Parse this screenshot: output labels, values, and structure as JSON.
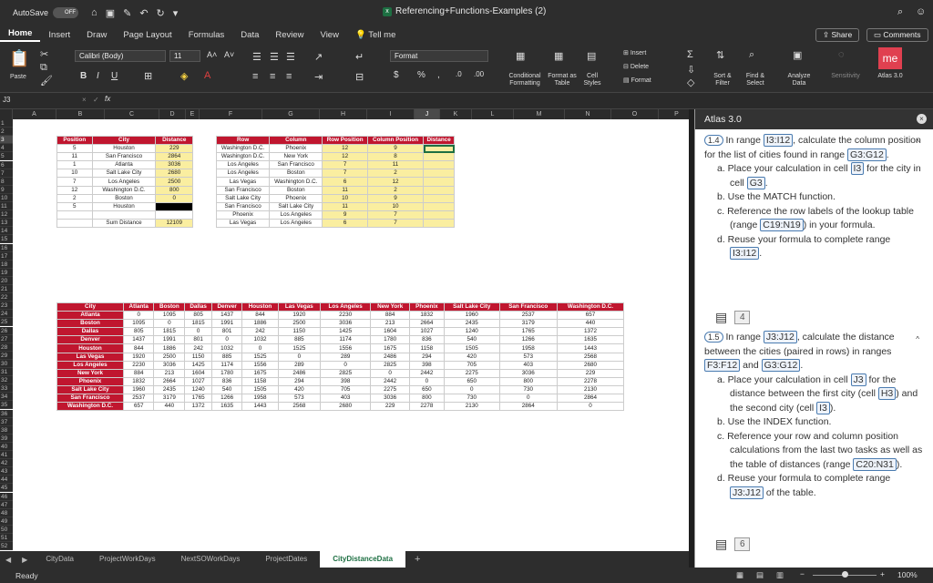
{
  "titlebar": {
    "autosave": "AutoSave",
    "toggle": "OFF",
    "doc_title": "Referencing+Functions-Examples (2)"
  },
  "tabs": [
    "Home",
    "Insert",
    "Draw",
    "Page Layout",
    "Formulas",
    "Data",
    "Review",
    "View"
  ],
  "tell_me": "Tell me",
  "share": "Share",
  "comments": "Comments",
  "ribbon": {
    "paste": "Paste",
    "font": "Calibri (Body)",
    "size": "11",
    "format": "Format",
    "cond": "Conditional Formatting",
    "fmt_table": "Format as Table",
    "cell_styles": "Cell Styles",
    "insert": "Insert",
    "delete": "Delete",
    "sort": "Sort & Filter",
    "find": "Find & Select",
    "analyze": "Analyze Data",
    "sensitivity": "Sensitivity",
    "atlas": "Atlas 3.0",
    "atlas_logo": "me"
  },
  "formula_bar": {
    "namebox": "J3",
    "fx": "fx"
  },
  "columns": [
    "A",
    "B",
    "C",
    "D",
    "E",
    "F",
    "G",
    "H",
    "I",
    "J",
    "K",
    "L",
    "M",
    "N",
    "O",
    "P"
  ],
  "table1": {
    "headers": [
      "Position",
      "City",
      "Distance"
    ],
    "rows": [
      [
        "5",
        "Houston",
        "229"
      ],
      [
        "11",
        "San Francisco",
        "2864"
      ],
      [
        "1",
        "Atlanta",
        "3036"
      ],
      [
        "10",
        "Salt Lake City",
        "2680"
      ],
      [
        "7",
        "Los Angeles",
        "2500"
      ],
      [
        "12",
        "Washington D.C.",
        "800"
      ],
      [
        "2",
        "Boston",
        "0"
      ],
      [
        "5",
        "Houston",
        ""
      ]
    ],
    "sum_label": "Sum Distance",
    "sum_value": "12109"
  },
  "table2": {
    "headers": [
      "Row",
      "Column",
      "Row Position",
      "Column Position",
      "Distance"
    ],
    "rows": [
      [
        "Washington D.C.",
        "Phoenix",
        "12",
        "9",
        ""
      ],
      [
        "Washington D.C.",
        "New York",
        "12",
        "8",
        ""
      ],
      [
        "Los Angeles",
        "San Francisco",
        "7",
        "11",
        ""
      ],
      [
        "Los Angeles",
        "Boston",
        "7",
        "2",
        ""
      ],
      [
        "Las Vegas",
        "Washington D.C.",
        "6",
        "12",
        ""
      ],
      [
        "San Francisco",
        "Boston",
        "11",
        "2",
        ""
      ],
      [
        "Salt Lake City",
        "Phoenix",
        "10",
        "9",
        ""
      ],
      [
        "San Francisco",
        "Salt Lake City",
        "11",
        "10",
        ""
      ],
      [
        "Phoenix",
        "Los Angeles",
        "9",
        "7",
        ""
      ],
      [
        "Las Vegas",
        "Los Angeles",
        "6",
        "7",
        ""
      ]
    ]
  },
  "matrix": {
    "headers": [
      "City",
      "Atlanta",
      "Boston",
      "Dallas",
      "Denver",
      "Houston",
      "Las Vegas",
      "Los Angeles",
      "New York",
      "Phoenix",
      "Salt Lake City",
      "San Francisco",
      "Washington D.C."
    ],
    "rows": [
      [
        "Atlanta",
        "0",
        "1095",
        "805",
        "1437",
        "844",
        "1920",
        "2230",
        "884",
        "1832",
        "1960",
        "2537",
        "657"
      ],
      [
        "Boston",
        "1095",
        "0",
        "1815",
        "1991",
        "1886",
        "2500",
        "3036",
        "213",
        "2664",
        "2435",
        "3179",
        "440"
      ],
      [
        "Dallas",
        "805",
        "1815",
        "0",
        "801",
        "242",
        "1150",
        "1425",
        "1604",
        "1027",
        "1240",
        "1765",
        "1372"
      ],
      [
        "Denver",
        "1437",
        "1991",
        "801",
        "0",
        "1032",
        "885",
        "1174",
        "1780",
        "836",
        "540",
        "1266",
        "1635"
      ],
      [
        "Houston",
        "844",
        "1886",
        "242",
        "1032",
        "0",
        "1525",
        "1556",
        "1675",
        "1158",
        "1505",
        "1958",
        "1443"
      ],
      [
        "Las Vegas",
        "1920",
        "2500",
        "1150",
        "885",
        "1525",
        "0",
        "289",
        "2486",
        "294",
        "420",
        "573",
        "2568"
      ],
      [
        "Los Angeles",
        "2230",
        "3036",
        "1425",
        "1174",
        "1556",
        "289",
        "0",
        "2825",
        "398",
        "705",
        "403",
        "2680"
      ],
      [
        "New York",
        "884",
        "213",
        "1604",
        "1780",
        "1675",
        "2486",
        "2825",
        "0",
        "2442",
        "2275",
        "3036",
        "229"
      ],
      [
        "Phoenix",
        "1832",
        "2664",
        "1027",
        "836",
        "1158",
        "294",
        "398",
        "2442",
        "0",
        "650",
        "800",
        "2278"
      ],
      [
        "Salt Lake City",
        "1960",
        "2435",
        "1240",
        "540",
        "1505",
        "420",
        "705",
        "2275",
        "650",
        "0",
        "730",
        "2130"
      ],
      [
        "San Francisco",
        "2537",
        "3179",
        "1765",
        "1266",
        "1958",
        "573",
        "403",
        "3036",
        "800",
        "730",
        "0",
        "2864"
      ],
      [
        "Washington D.C.",
        "657",
        "440",
        "1372",
        "1635",
        "1443",
        "2568",
        "2680",
        "229",
        "2278",
        "2130",
        "2864",
        "0"
      ]
    ]
  },
  "sheet_tabs": [
    "CityData",
    "ProjectWorkDays",
    "NextSOWorkDays",
    "ProjectDates",
    "CityDistanceData"
  ],
  "status": {
    "ready": "Ready",
    "zoom": "100%"
  },
  "pane": {
    "title": "Atlas 3.0",
    "t14": {
      "num": "1.4",
      "intro_a": "In range ",
      "r1": "I3:I12",
      "intro_b": ", calculate the column position for the list of cities found in range ",
      "r2": "G3:G12",
      "intro_c": ".",
      "a": "a. Place your calculation in cell ",
      "a_ref": "I3",
      "a_b": " for the city in cell ",
      "a_ref2": "G3",
      "a_c": ".",
      "b": "b. Use the MATCH function.",
      "c": "c. Reference the row labels of the lookup table (range ",
      "c_ref": "C19:N19",
      "c_b": ") in your formula.",
      "d": "d. Reuse your formula to complete range ",
      "d_ref": "I3:I12",
      "d_b": ".",
      "count": "4"
    },
    "t15": {
      "num": "1.5",
      "intro_a": "In range ",
      "r1": "J3:J12",
      "intro_b": ", calculate the distance between the cities (paired in rows) in ranges ",
      "r2": "F3:F12",
      "intro_c": " and ",
      "r3": "G3:G12",
      "intro_d": ".",
      "a": "a. Place your calculation in cell ",
      "a_ref": "J3",
      "a_b": " for the distance between the first city (cell ",
      "a_ref2": "H3",
      "a_c": ") and the second city (cell ",
      "a_ref3": "I3",
      "a_d": ").",
      "b": "b. Use the INDEX function.",
      "c": "c. Reference your row and column position calculations from the last two tasks as well as the table of distances (range ",
      "c_ref": "C20:N31",
      "c_b": ").",
      "d": "d. Reuse your formula to complete range ",
      "d_ref": "J3:J12",
      "d_b": " of the table.",
      "count": "6"
    }
  }
}
